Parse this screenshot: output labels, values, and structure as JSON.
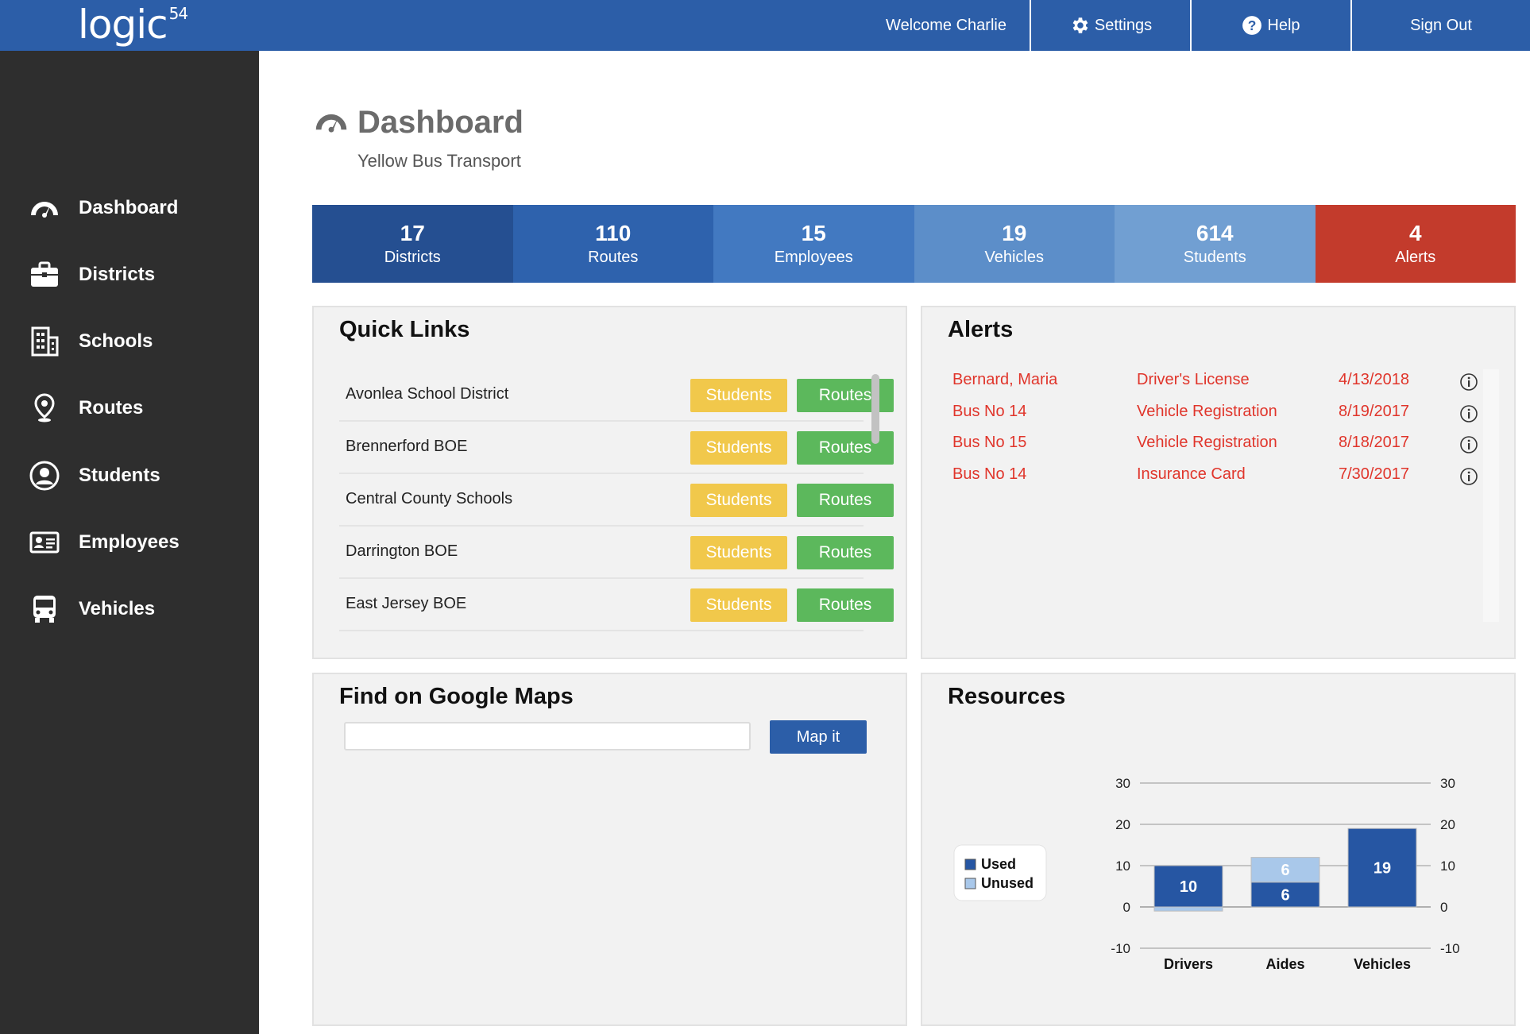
{
  "app": {
    "logo_text": "logic",
    "logo_sup": "54",
    "welcome": "Welcome  Charlie",
    "nav": {
      "settings": "Settings",
      "help": "Help",
      "sign_out": "Sign Out"
    }
  },
  "sidebar": {
    "items": [
      {
        "label": "Dashboard",
        "icon": "dashboard-gauge-icon"
      },
      {
        "label": "Districts",
        "icon": "briefcase-icon"
      },
      {
        "label": "Schools",
        "icon": "building-icon"
      },
      {
        "label": "Routes",
        "icon": "map-pin-icon"
      },
      {
        "label": "Students",
        "icon": "user-circle-icon"
      },
      {
        "label": "Employees",
        "icon": "id-card-icon"
      },
      {
        "label": "Vehicles",
        "icon": "bus-icon"
      }
    ]
  },
  "page": {
    "title": "Dashboard",
    "subtitle": "Yellow Bus Transport"
  },
  "stats": [
    {
      "value": "17",
      "label": "Districts",
      "color": "#254f91"
    },
    {
      "value": "110",
      "label": "Routes",
      "color": "#2e62ad"
    },
    {
      "value": "15",
      "label": "Employees",
      "color": "#4279c1"
    },
    {
      "value": "19",
      "label": "Vehicles",
      "color": "#5c8ec9"
    },
    {
      "value": "614",
      "label": "Students",
      "color": "#719fd2"
    },
    {
      "value": "4",
      "label": "Alerts",
      "color": "#c33b2c"
    }
  ],
  "quick_links": {
    "title": "Quick Links",
    "students_label": "Students",
    "routes_label": "Routes",
    "items": [
      {
        "name": "Avonlea School District"
      },
      {
        "name": "Brennerford BOE"
      },
      {
        "name": "Central County Schools"
      },
      {
        "name": "Darrington BOE"
      },
      {
        "name": "East Jersey BOE"
      }
    ]
  },
  "alerts": {
    "title": "Alerts",
    "items": [
      {
        "subject": "Bernard, Maria",
        "type": "Driver's License",
        "date": "4/13/2018"
      },
      {
        "subject": "Bus No 14",
        "type": "Vehicle Registration",
        "date": "8/19/2017"
      },
      {
        "subject": "Bus No 15",
        "type": "Vehicle Registration",
        "date": "8/18/2017"
      },
      {
        "subject": "Bus No 14",
        "type": "Insurance Card",
        "date": "7/30/2017"
      }
    ]
  },
  "maps": {
    "title": "Find on Google Maps",
    "input_value": "",
    "button_label": "Map it"
  },
  "resources": {
    "title": "Resources"
  },
  "chart_data": {
    "type": "bar",
    "stacked": true,
    "categories": [
      "Drivers",
      "Aides",
      "Vehicles"
    ],
    "series": [
      {
        "name": "Used",
        "values": [
          10,
          6,
          19
        ],
        "color": "#2656a3"
      },
      {
        "name": "Unused",
        "values": [
          -1,
          6,
          0
        ],
        "color": "#a9c8ea"
      }
    ],
    "data_labels": [
      {
        "category": "Drivers",
        "series": "Used",
        "text": "10"
      },
      {
        "category": "Aides",
        "series": "Used",
        "text": "6"
      },
      {
        "category": "Aides",
        "series": "Unused",
        "text": "6"
      },
      {
        "category": "Vehicles",
        "series": "Used",
        "text": "19"
      }
    ],
    "ylim": [
      -10,
      30
    ],
    "yticks": [
      -10,
      0,
      10,
      20,
      30
    ],
    "secondary_axis": true,
    "grid": true,
    "legend_position": "left"
  }
}
